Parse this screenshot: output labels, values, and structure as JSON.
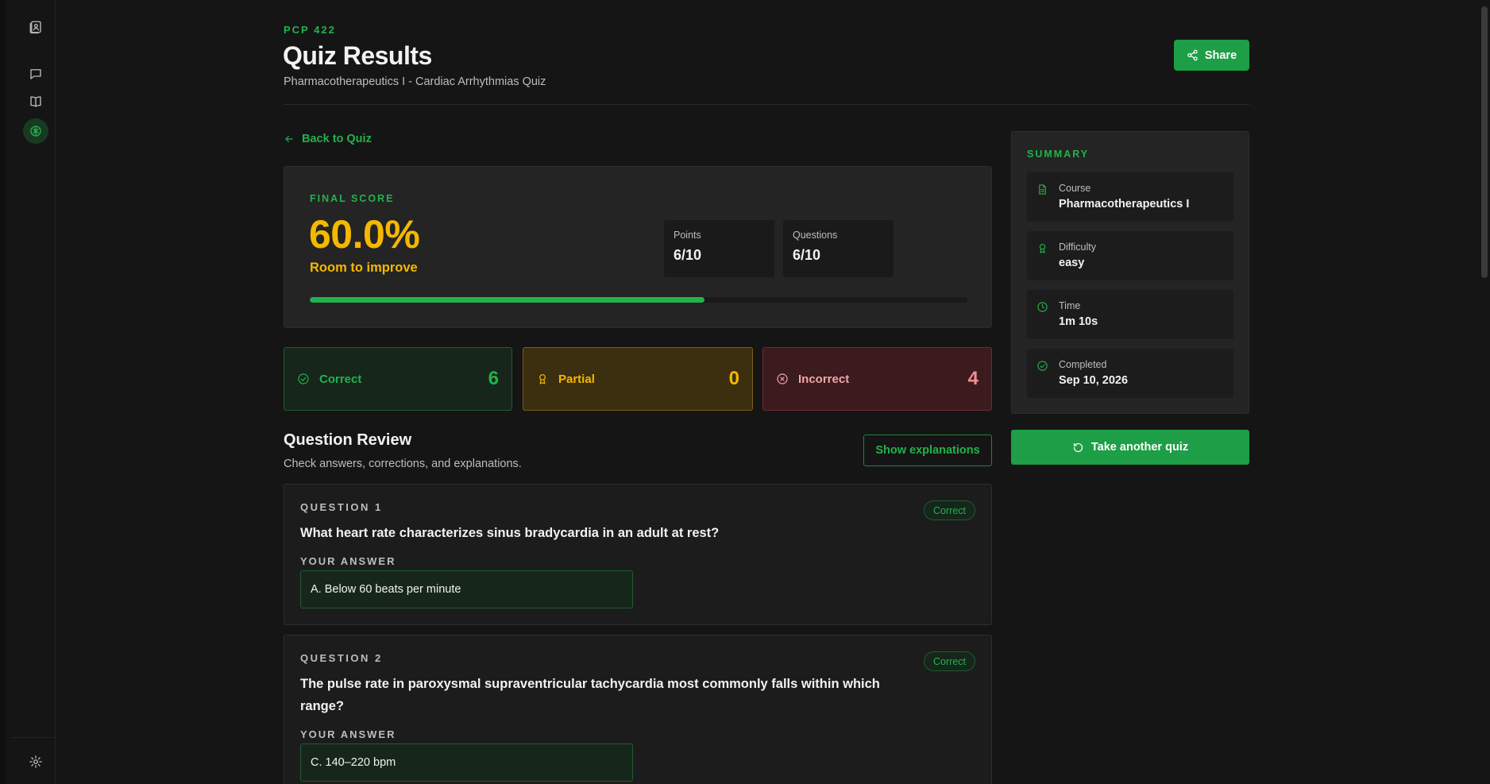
{
  "header": {
    "course_code": "PCP 422",
    "title": "Quiz Results",
    "subtitle": "Pharmacotherapeutics I - Cardiac Arrhythmias Quiz",
    "share_label": "Share"
  },
  "back_link": "Back to Quiz",
  "score": {
    "label": "FINAL SCORE",
    "value": "60.0%",
    "remark": "Room to improve",
    "progress": 0.6,
    "points_label": "Points",
    "points_value": "6/10",
    "questions_label": "Questions",
    "questions_value": "6/10"
  },
  "tiles": {
    "correct_label": "Correct",
    "correct_count": "6",
    "partial_label": "Partial",
    "partial_count": "0",
    "incorrect_label": "Incorrect",
    "incorrect_count": "4"
  },
  "review": {
    "title": "Question Review",
    "subtitle": "Check answers, corrections, and explanations.",
    "explain_label": "Show explanations",
    "answer_label": "YOUR ANSWER",
    "questions": [
      {
        "number": "QUESTION 1",
        "text": "What heart rate characterizes sinus bradycardia in an adult at rest?",
        "status": "Correct",
        "answer": "A. Below 60 beats per minute"
      },
      {
        "number": "QUESTION 2",
        "text": "The pulse rate in paroxysmal supraventricular tachycardia most commonly falls within which range?",
        "status": "Correct",
        "answer": "C. 140–220 bpm"
      }
    ]
  },
  "summary": {
    "label": "SUMMARY",
    "items": [
      {
        "label": "Course",
        "value": "Pharmacotherapeutics I",
        "icon": "document-icon"
      },
      {
        "label": "Difficulty",
        "value": "easy",
        "icon": "award-icon"
      },
      {
        "label": "Time",
        "value": "1m 10s",
        "icon": "clock-icon"
      },
      {
        "label": "Completed",
        "value": "Sep 10, 2026",
        "icon": "check-circle-icon"
      }
    ],
    "retake_label": "Take another quiz"
  },
  "colors": {
    "accent": "#22b24c",
    "score": "#f5b800",
    "incorrect": "#f28c92",
    "background": "#151515"
  }
}
